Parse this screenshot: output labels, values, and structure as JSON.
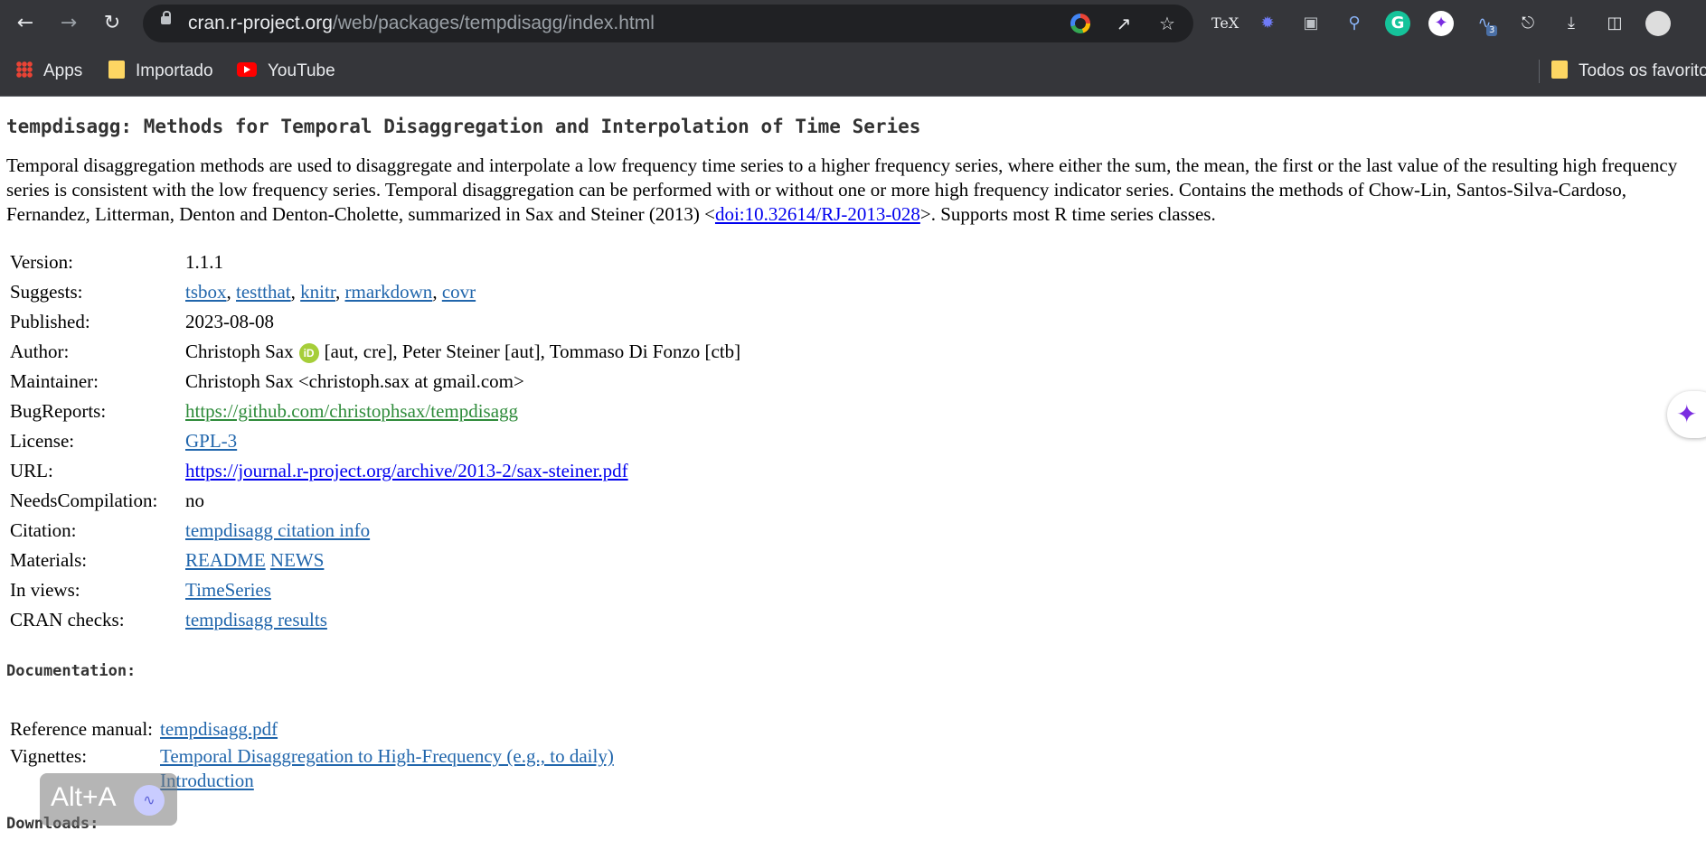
{
  "browser": {
    "url_host": "cran.r-project.org",
    "url_path": "/web/packages/tempdisagg/index.html",
    "bookmarks": [
      {
        "label": "Apps",
        "icon": "apps-grid-icon"
      },
      {
        "label": "Importado",
        "icon": "folder-icon"
      },
      {
        "label": "YouTube",
        "icon": "youtube-icon"
      }
    ],
    "bookmarks_right": "Todos os favoritos",
    "extension_badge": "3",
    "colors": {
      "chrome": "#35363a",
      "omnibox": "#202124",
      "link": "#2166ac",
      "bug_link": "#2e8b3a"
    }
  },
  "page": {
    "title": "tempdisagg: Methods for Temporal Disaggregation and Interpolation of Time Series",
    "description_before": "Temporal disaggregation methods are used to disaggregate and interpolate a low frequency time series to a higher frequency series, where either the sum, the mean, the first or the last value of the resulting high frequency series is consistent with the low frequency series. Temporal disaggregation can be performed with or without one or more high frequency indicator series. Contains the methods of Chow-Lin, Santos-Silva-Cardoso, Fernandez, Litterman, Denton and Denton-Cholette, summarized in Sax and Steiner (2013) <",
    "description_link": "doi:10.32614/RJ-2013-028",
    "description_after": ">. Supports most R time series classes.",
    "info": {
      "version_label": "Version:",
      "version": "1.1.1",
      "suggests_label": "Suggests:",
      "suggests": [
        "tsbox",
        "testthat",
        "knitr",
        "rmarkdown",
        "covr"
      ],
      "published_label": "Published:",
      "published": "2023-08-08",
      "author_label": "Author:",
      "author_name": "Christoph Sax",
      "orcid": "iD",
      "author_rest": "[aut, cre], Peter Steiner [aut], Tommaso Di Fonzo [ctb]",
      "maintainer_label": "Maintainer:",
      "maintainer": "Christoph Sax <christoph.sax at gmail.com>",
      "bugreports_label": "BugReports:",
      "bugreports": "https://github.com/christophsax/tempdisagg",
      "license_label": "License:",
      "license": "GPL-3",
      "url_label": "URL:",
      "url": "https://journal.r-project.org/archive/2013-2/sax-steiner.pdf",
      "needscompilation_label": "NeedsCompilation:",
      "needscompilation": "no",
      "citation_label": "Citation:",
      "citation": "tempdisagg citation info",
      "materials_label": "Materials:",
      "materials": [
        "README",
        "NEWS"
      ],
      "views_label": "In views:",
      "views": "TimeSeries",
      "checks_label": "CRAN checks:",
      "checks": "tempdisagg results"
    },
    "documentation_heading": "Documentation:",
    "docs": {
      "manual_label": "Reference manual:",
      "manual": "tempdisagg.pdf",
      "vignettes_label": "Vignettes:",
      "vignettes": [
        "Temporal Disaggregation to High-Frequency (e.g., to daily)",
        "Introduction"
      ]
    },
    "downloads_heading": "Downloads:"
  },
  "overlay": {
    "alt_shortcut": "Alt+A"
  }
}
